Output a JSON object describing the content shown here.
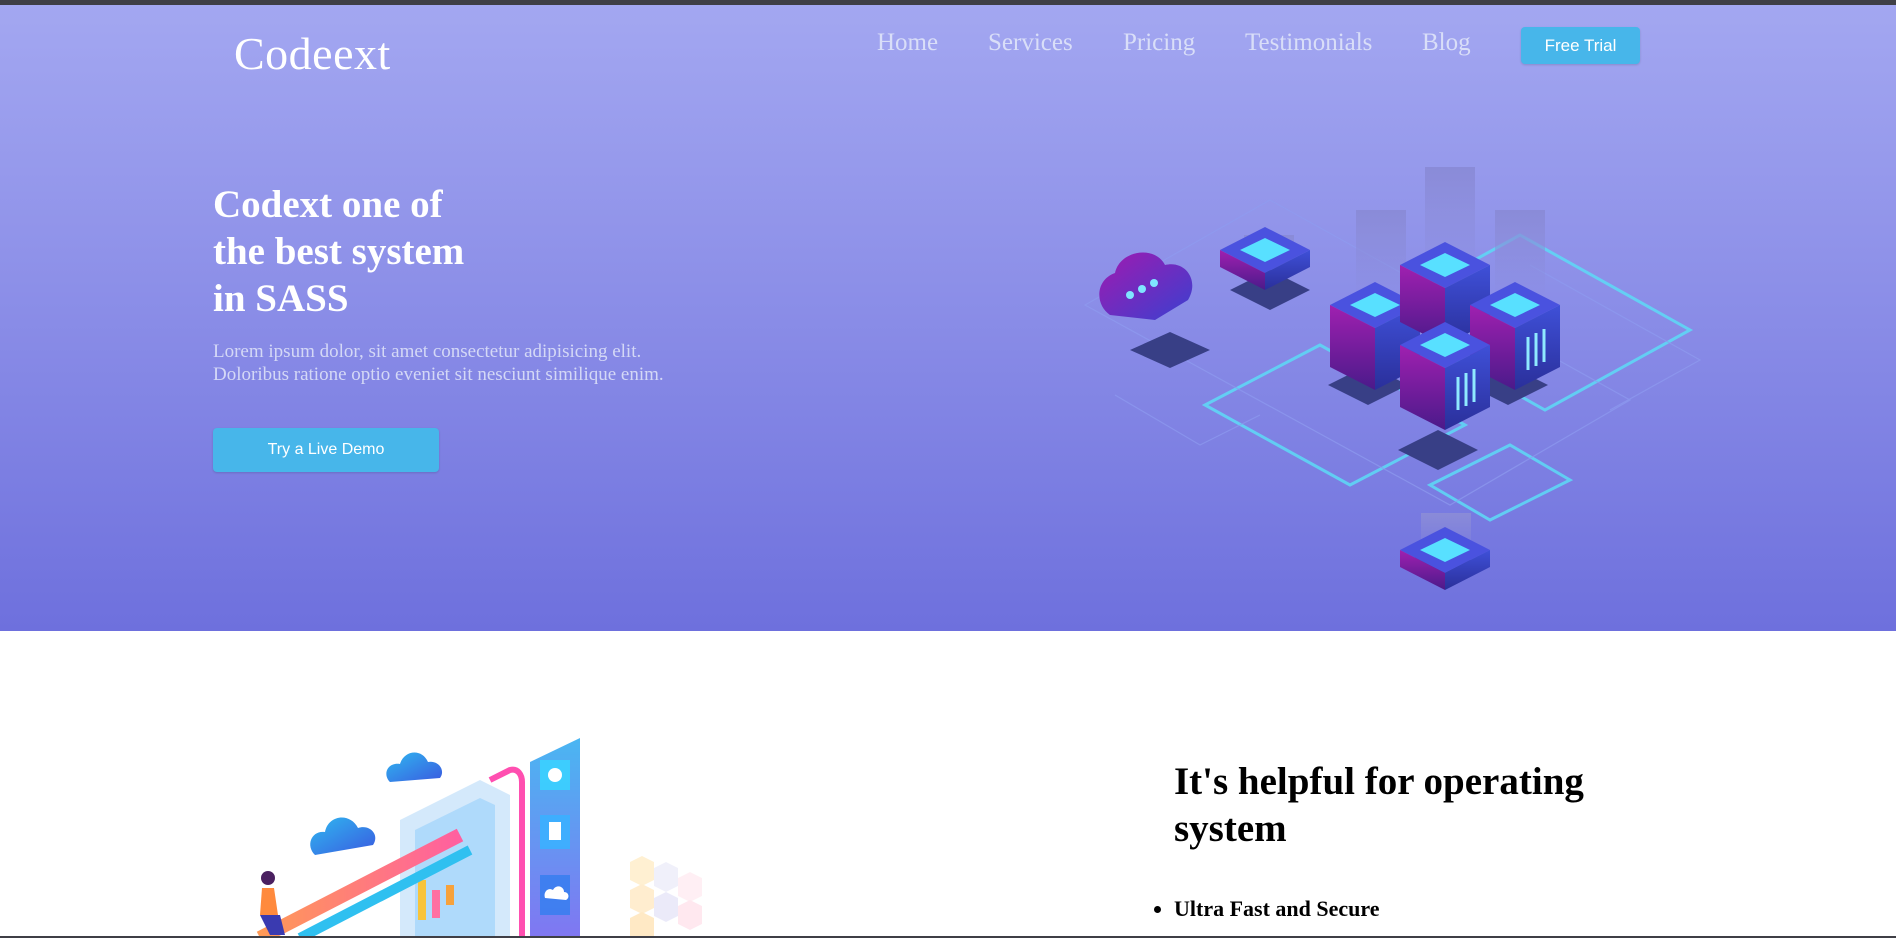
{
  "brand": {
    "logo": "Codeext"
  },
  "nav": {
    "items": [
      "Home",
      "Services",
      "Pricing",
      "Testimonials",
      "Blog"
    ],
    "cta_label": "Free Trial"
  },
  "hero": {
    "title_lines": [
      "Codext one of",
      "the best system",
      "in SASS"
    ],
    "description": "Lorem ipsum dolor, sit amet consectetur adipisicing elit. Doloribus ratione optio eveniet sit nesciunt similique enim.",
    "cta_label": "Try a Live Demo"
  },
  "feature": {
    "title_lines": [
      "It's helpful for operating",
      "system"
    ],
    "items": [
      "Ultra Fast and Secure"
    ]
  },
  "colors": {
    "hero_gradient_top": "#a3a7f1",
    "hero_gradient_bottom": "#6e70dd",
    "button": "#47b6ea",
    "nav_text": "#d9def8"
  }
}
